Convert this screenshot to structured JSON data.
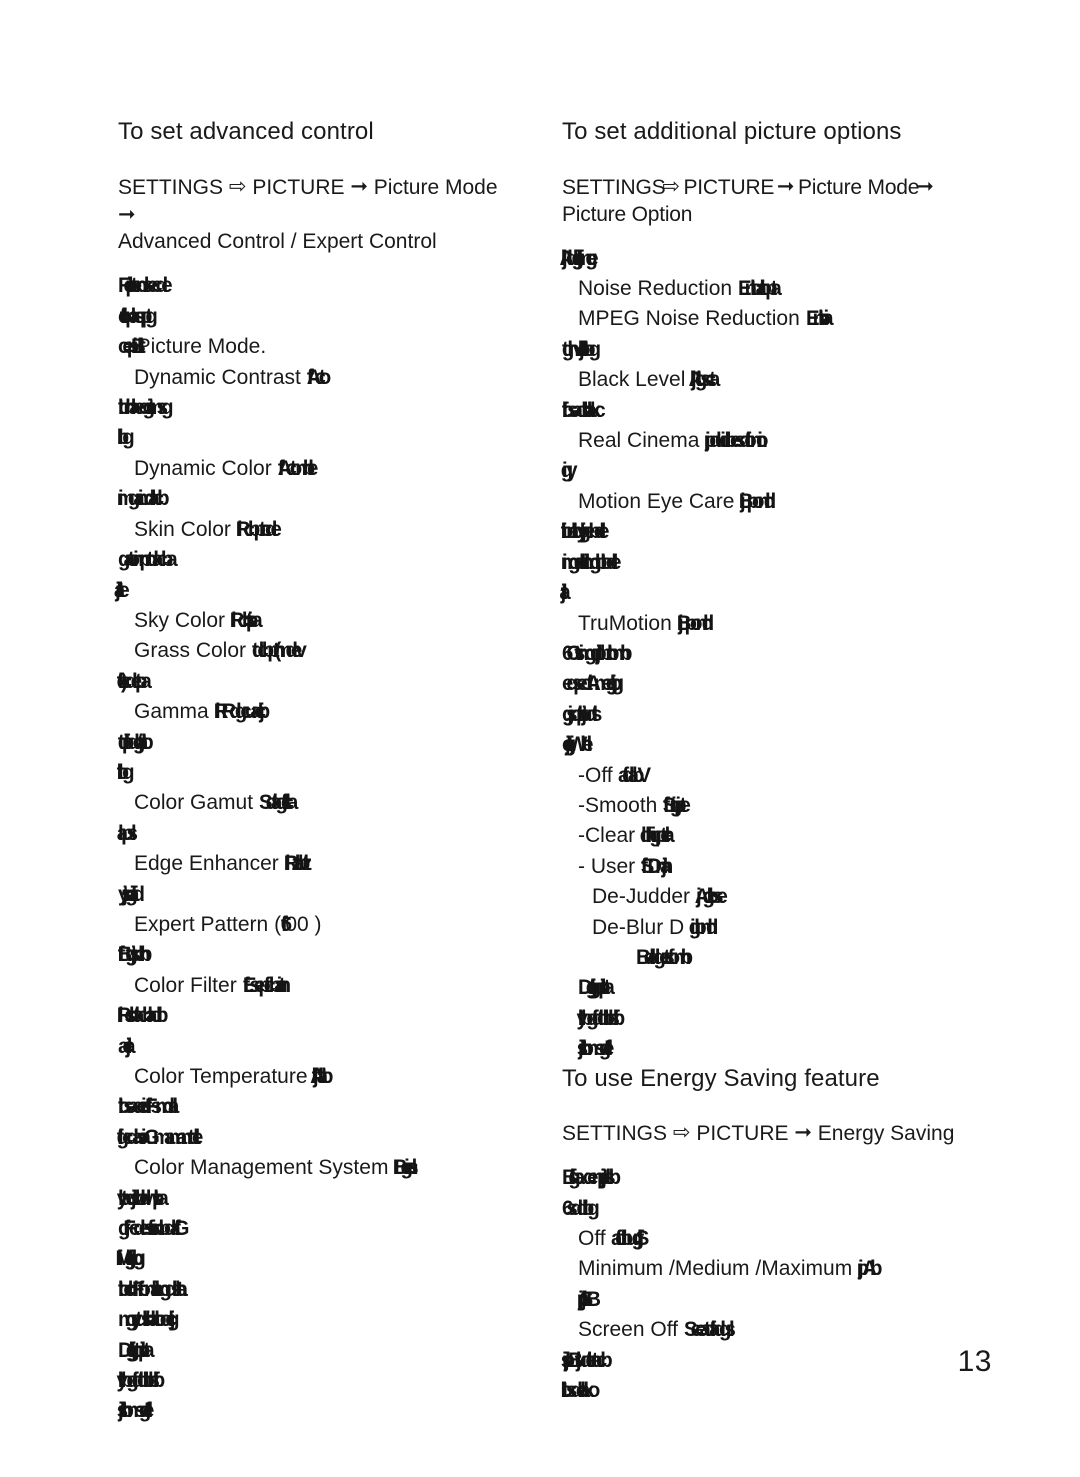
{
  "page": {
    "number": "13"
  },
  "glyphs": {
    "arrow_hollow": "⇨",
    "arrow_solid": "➞"
  },
  "left_column": {
    "heading": "To set advanced control",
    "path": {
      "part1": "SETTINGS",
      "part2": "PICTURE",
      "part3": "Picture Mode",
      "part4": "Advanced Control / Expert Control"
    },
    "lines": [
      {
        "indent": 0,
        "text": "Felipten dsecde",
        "garbled": true
      },
      {
        "indent": 0,
        "text": "clitfoplas qptg",
        "garbled": true
      },
      {
        "indent": 0,
        "text": "cepiBttii",
        "garbled": true,
        "suffix": "Picture Mode."
      },
      {
        "indent": 1,
        "text": "Dynamic Contrast ",
        "garbled": false,
        "tail": "ffActo"
      },
      {
        "indent": 0,
        "text": "tbn blaecgtiimsg",
        "garbled": true
      },
      {
        "indent": 0,
        "text": "lbg",
        "garbled": true
      },
      {
        "indent": 1,
        "text": "Dynamic Color ",
        "garbled": false,
        "tail": "ffActom ble"
      },
      {
        "indent": 0,
        "text": "imgaim dlacb",
        "garbled": true
      },
      {
        "indent": 1,
        "text": "Skin Color ",
        "garbled": false,
        "tail": "lRcbptn cde"
      },
      {
        "indent": 0,
        "text": "gattoim pn tdacba",
        "garbled": true
      },
      {
        "indent": 0,
        "text": "ttlljae",
        "garbled": true
      },
      {
        "indent": 1,
        "text": "Sky Color ",
        "garbled": false,
        "tail": "lRcbittpa"
      },
      {
        "indent": 1,
        "text": "Grass Color ",
        "garbled": false,
        "tail": "tdcbptn (mdev"
      },
      {
        "indent": 0,
        "text": "lte)cdetpa",
        "garbled": true
      },
      {
        "indent": 1,
        "text": "Gamma ",
        "garbled": false,
        "tail": "lRRdgcuacjb"
      },
      {
        "indent": 0,
        "text": "ttdfipdgjtatb",
        "garbled": true
      },
      {
        "indent": 0,
        "text": "ltbg",
        "garbled": true
      },
      {
        "indent": 1,
        "text": "Color Gamut ",
        "garbled": false,
        "tail": "Sdtagfclltca"
      },
      {
        "indent": 0,
        "text": "lapsl",
        "garbled": true
      },
      {
        "indent": 1,
        "text": "Edge Enhancer ",
        "garbled": false,
        "tail": "lRzlabltz"
      },
      {
        "indent": 0,
        "text": "ytjsgftiiad",
        "garbled": true
      },
      {
        "indent": 1,
        "text": "Expert Pattern (",
        "garbled": false,
        "tail": "ff6",
        "tail2": "00 )"
      },
      {
        "indent": 0,
        "text": "fffBtgtjsch b",
        "garbled": true
      },
      {
        "indent": 1,
        "text": "Color Filter ",
        "garbled": false,
        "tail": "fEsepfc cbatn  in"
      },
      {
        "indent": 0,
        "text": "lRsldtacbladb",
        "garbled": true
      },
      {
        "indent": 0,
        "text": "aclja",
        "garbled": true
      },
      {
        "indent": 1,
        "text": "Color Temperature ",
        "garbled": false,
        "tail": "jfflAlatb"
      },
      {
        "indent": 0,
        "text": "tbsaceidfFsm dal",
        "garbled": true
      },
      {
        "indent": 0,
        "text": "lfgcdasiaGmam am tdle.",
        "garbled": true
      },
      {
        "indent": 1,
        "text": "Color Management System ",
        "garbled": false,
        "tail": "IBgn  iesl"
      },
      {
        "indent": 0,
        "text": "lytadjsc bldwtlpa",
        "garbled": true
      },
      {
        "indent": 0,
        "text": "gfFcdestfon  iscbdaffG",
        "garbled": true
      },
      {
        "indent": 0,
        "text": "ilMlgjlab g",
        "garbled": true
      },
      {
        "indent": 0,
        "text": "tbcldFfrom lalim gdsh ta",
        "garbled": true
      },
      {
        "indent": 0,
        "text": "m gytdsirblac bocjlg",
        "garbled": true
      },
      {
        "indent": 0,
        "text": "Dgjtitlgrtdipta",
        "garbled": true
      },
      {
        "indent": 0,
        "text": "ttlybgffdtdbln sfb",
        "garbled": true
      },
      {
        "indent": 0,
        "text": "jslh tbm sgfIel",
        "garbled": true
      }
    ]
  },
  "right_column": {
    "heading": "To set additional picture options",
    "path": {
      "part1": "SETTINGS",
      "part2": "PICTURE",
      "part3": "Picture Mode",
      "part4": "Picture Option"
    },
    "lines": [
      {
        "indent": 0,
        "text": "jlAldgfjfimg e",
        "garbled": true
      },
      {
        "indent": 1,
        "text": "Noise Reduction ",
        "garbled": false,
        "tail": "Entbairtbpta"
      },
      {
        "indent": 1,
        "text": "MPEG N",
        "garbled": false,
        "mid": "oise Reduction ",
        "tail": "Entbia"
      },
      {
        "indent": 0,
        "text": "tghvcltljbtbg",
        "garbled": true
      },
      {
        "indent": 1,
        "text": "Black Level ",
        "garbled": false,
        "tail": "jlAtlgscta"
      },
      {
        "indent": 0,
        "text": "tfbsadttblakc",
        "garbled": true
      },
      {
        "indent": 1,
        "text": "Real C",
        "garbled": false,
        "mid": "inema ",
        "tail": "jpduidbesdfom io"
      },
      {
        "indent": 0,
        "text": "igy",
        "garbled": true
      },
      {
        "indent": 1,
        "text": "Motion Eye Care ",
        "garbled": false,
        "tail": "jBpom ld"
      },
      {
        "indent": 0,
        "text": "itbn albyjlgebdle",
        "garbled": true
      },
      {
        "indent": 0,
        "text": "im gdtldtim gbtbdle",
        "garbled": true
      },
      {
        "indent": 0,
        "text": "ltja",
        "garbled": true
      },
      {
        "indent": 1,
        "text": "TruMotion ",
        "garbled": false,
        "tail": "jBpom ld"
      },
      {
        "indent": 0,
        "text": "6Ctsim gdtjpbn tbm b",
        "garbled": true
      },
      {
        "indent": 0,
        "text": "eqsedtAm egjtb g",
        "garbled": true
      },
      {
        "indent": 0,
        "text": "gjsdtptjudts",
        "garbled": true
      },
      {
        "indent": 0,
        "text": "ctljgjWh el",
        "garbled": true
      },
      {
        "indent": 1,
        "text": "-Off ",
        "garbled": false,
        "tail": "aftdabV"
      },
      {
        "indent": 1,
        "text": "-Smooth ",
        "garbled": false,
        "tail": "ffSn igjpte"
      },
      {
        "indent": 1,
        "text": "-Clear ",
        "garbled": false,
        "tail": "ldfhigptcla"
      },
      {
        "indent": 1,
        "text": "- User ",
        "garbled": false,
        "tail": "ffSDm lja"
      },
      {
        "indent": 2,
        "text": "De-Judder ",
        "garbled": false,
        "tail": "jAgltbse"
      },
      {
        "indent": 2,
        "text": "De-Blur D",
        "garbled": false,
        "mid": " ",
        "tail": "igbm ld"
      },
      {
        "indent": 3,
        "text": "Bdldgetsfom b",
        "garbled": true
      },
      {
        "indent": 1,
        "text": "Dgjtltgdtipta",
        "garbled": true
      },
      {
        "indent": 1,
        "text": "ttlybgffdtdbln sfb",
        "garbled": true
      },
      {
        "indent": 1,
        "text": "jslh tbm sgfIel",
        "garbled": true
      }
    ]
  },
  "energy_saving": {
    "heading": "To use Energy Saving feature",
    "path": {
      "part1": "SETTINGS",
      "part2": "PICTURE",
      "part3": "Energy Saving"
    },
    "lines": [
      {
        "indent": 0,
        "text": "BflgaxcenpIjjdsb",
        "garbled": true
      },
      {
        "indent": 0,
        "text": "6sddbg",
        "garbled": true
      },
      {
        "indent": 1,
        "text": "Off ",
        "garbled": false,
        "tail": "aftdbugfjS"
      },
      {
        "indent": 1,
        "text": "Minimum /Medium /Maximum ",
        "garbled": false,
        "tail": "jpAb"
      },
      {
        "indent": 1,
        "text": "jpltjSB",
        "garbled": true
      },
      {
        "indent": 1,
        "text": "Screen Off ",
        "garbled": false,
        "tail": "Sceatdfadgsl"
      },
      {
        "indent": 0,
        "text": "isljpBjtudten tacb",
        "garbled": true
      },
      {
        "indent": 0,
        "text": "ttlbsdelako",
        "garbled": true
      }
    ]
  }
}
